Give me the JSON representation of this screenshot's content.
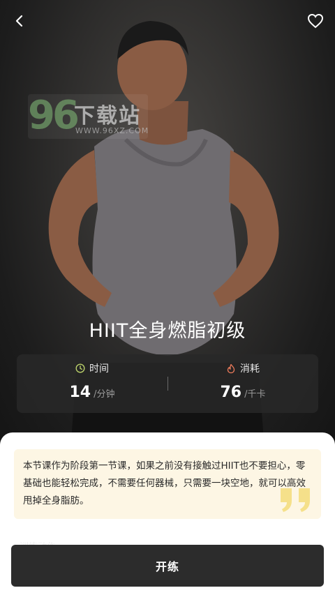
{
  "watermark": {
    "number": "96",
    "name": "下载站",
    "url": "WWW.96XZ.COM"
  },
  "course": {
    "title": "HIIT全身燃脂初级"
  },
  "stats": {
    "time": {
      "label": "时间",
      "value": "14",
      "unit": "/分钟"
    },
    "calories": {
      "label": "消耗",
      "value": "76",
      "unit": "/千卡"
    }
  },
  "description": "本节课作为阶段第一节课，如果之前没有接触过HIIT也不要担心，零基础也能轻松完成，不需要任何器械，只需要一块空地，就可以高效甩掉全身脂肪。",
  "section_label": "训练动作",
  "actions": {
    "start_label": "开练"
  },
  "icons": {
    "back": "back-arrow-icon",
    "favorite": "heart-icon",
    "time": "clock-icon",
    "calories": "flame-icon",
    "quote": "quote-icon"
  },
  "colors": {
    "time_icon": "#b9cf6a",
    "flame_icon": "#e8795a",
    "desc_bg": "#fdf6e4",
    "quote": "#f5e08a",
    "button_bg": "#2c2c2c"
  }
}
